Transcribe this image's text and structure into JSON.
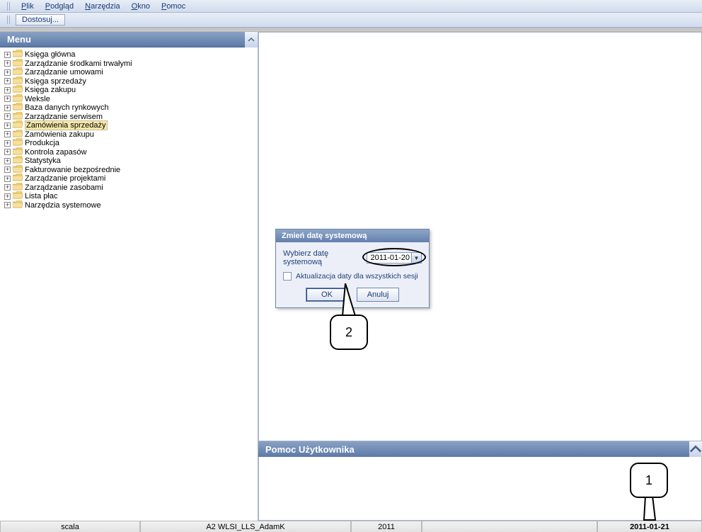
{
  "menubar": {
    "items": [
      {
        "first": "P",
        "rest": "lik"
      },
      {
        "first": "P",
        "rest": "odgląd"
      },
      {
        "first": "N",
        "rest": "arzędzia"
      },
      {
        "first": "O",
        "rest": "kno"
      },
      {
        "first": "P",
        "rest": "omoc"
      }
    ]
  },
  "toolbar": {
    "customize_label": "Dostosuj..."
  },
  "sidebar": {
    "title": "Menu",
    "items": [
      "Księga główna",
      "Zarządzanie środkami trwałymi",
      "Zarządzanie umowami",
      "Księga sprzedaży",
      "Księga zakupu",
      "Weksle",
      "Baza danych rynkowych",
      "Zarządzanie serwisem",
      "Zamówienia sprzedaży",
      "Zamówienia zakupu",
      "Produkcja",
      "Kontrola zapasów",
      "Statystyka",
      "Fakturowanie bezpośrednie",
      "Zarządzanie projektami",
      "Zarządzanie zasobami",
      "Lista płac",
      "Narzędzia systemowe"
    ],
    "selected_index": 8
  },
  "help_panel": {
    "title": "Pomoc Użytkownika"
  },
  "dialog": {
    "title": "Zmień datę systemową",
    "label_pick": "Wybierz datę systemową",
    "date_value": "2011-01-20",
    "checkbox_label": "Aktualizacja daty dla wszystkich sesji",
    "ok_label": "OK",
    "cancel_label": "Anuluj"
  },
  "callouts": {
    "c1": "1",
    "c2": "2"
  },
  "statusbar": {
    "cell1": "scala",
    "cell2": "A2 WLSI_LLS_AdamK",
    "cell3": "2011",
    "cell4": "",
    "cell5": "2011-01-21"
  }
}
